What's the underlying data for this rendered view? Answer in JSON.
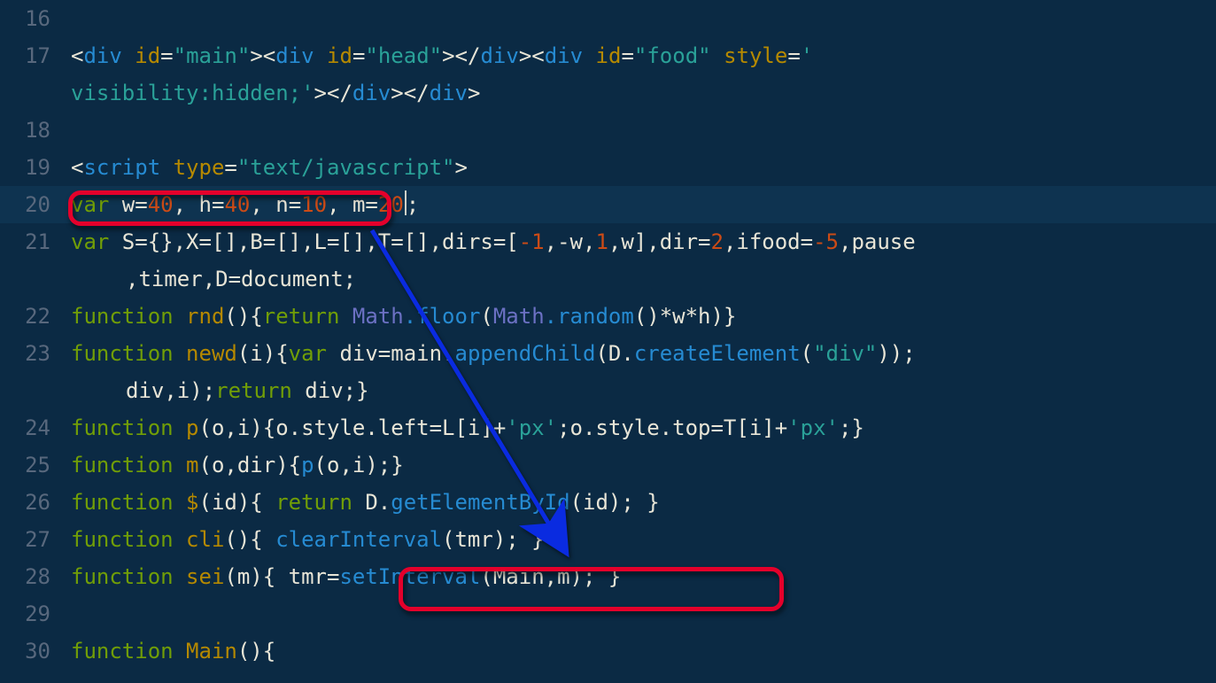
{
  "lines": {
    "l16_num": "16",
    "l17_num": "17",
    "l18_num": "18",
    "l19_num": "19",
    "l20_num": "20",
    "l21_num": "21",
    "l22_num": "22",
    "l23_num": "23",
    "l24_num": "24",
    "l25_num": "25",
    "l26_num": "26",
    "l27_num": "27",
    "l28_num": "28",
    "l29_num": "29",
    "l30_num": "30"
  },
  "code": {
    "l17_a": "<",
    "l17_div1": "div",
    "l17_sp": " ",
    "l17_id": "id",
    "l17_eq": "=",
    "l17_main": "\"main\"",
    "l17_b": "><",
    "l17_div2": "div",
    "l17_id2": "id",
    "l17_head": "\"head\"",
    "l17_c": "></",
    "l17_div3": "div",
    "l17_d": "><",
    "l17_div4": "div",
    "l17_id3": "id",
    "l17_food": "\"food\"",
    "l17_style": "style",
    "l17_stylev": "'",
    "l17w_vis": "visibility:hidden;'",
    "l17w_e": "></",
    "l17w_div5": "div",
    "l17w_f": "></",
    "l17w_div6": "div",
    "l17w_g": ">",
    "l19_a": "<",
    "l19_script": "script",
    "l19_type": "type",
    "l19_tval": "\"text/javascript\"",
    "l19_b": ">",
    "l20_var": "var",
    "l20_w": " w",
    "l20_eq": "=",
    "l20_n1": "40",
    "l20_c1": ", h",
    "l20_n2": "40",
    "l20_c2": ", n",
    "l20_n3": "10",
    "l20_c3": ", m",
    "l20_n4": "20",
    "l20_end": ";",
    "l21_var": "var",
    "l21_body": " S={},X=[],B=[],L=[],T=[],dirs=[",
    "l21_neg1": "-1",
    "l21_mid1": ",-w,",
    "l21_one": "1",
    "l21_mid2": ",w],dir=",
    "l21_two": "2",
    "l21_mid3": ",ifood=",
    "l21_neg5": "-5",
    "l21_tail": ",pause",
    "l21w_wrap": ",timer,D=document;",
    "l22_fn": "function",
    "l22_name": " rnd",
    "l22_a": "(){",
    "l22_ret": "return",
    "l22_math": " Math",
    "l22_floor": ".floor",
    "l22_b": "(",
    "l22_math2": "Math",
    "l22_rand": ".random",
    "l22_c": "()*w*h)}",
    "l23_fn": "function",
    "l23_name": " newd",
    "l23_a": "(i){",
    "l23_var": "var",
    "l23_b": " div=main.",
    "l23_app": "appendChild",
    "l23_c": "(D.",
    "l23_ce": "createElement",
    "l23_d": "(",
    "l23_divs": "\"div\"",
    "l23_e": "));",
    "l23w_wrap_a": "div,i);",
    "l23w_ret": "return",
    "l23w_wrap_b": " div;}",
    "l24_fn": "function",
    "l24_name": " p",
    "l24_a": "(o,i){o.style.left=L[i]+",
    "l24_px1": "'px'",
    "l24_b": ";o.style.top=T[i]+",
    "l24_px2": "'px'",
    "l24_c": ";}",
    "l25_fn": "function",
    "l25_name": " m",
    "l25_a": "(o,dir){",
    "l25_p": "p",
    "l25_b": "(o,i);}",
    "l26_fn": "function",
    "l26_name": " $",
    "l26_a": "(id){ ",
    "l26_ret": "return",
    "l26_b": " D.",
    "l26_gebi": "getElementById",
    "l26_c": "(id); }",
    "l27_fn": "function",
    "l27_name": " cli",
    "l27_a": "(){ ",
    "l27_ci": "clearInterval",
    "l27_b": "(tmr); }",
    "l28_fn": "function",
    "l28_name": " sei",
    "l28_a": "(m){ tmr=",
    "l28_si": "setInterval",
    "l28_b": "(Main,m); }",
    "l30_fn": "function",
    "l30_name": " Main",
    "l30_a": "(){"
  }
}
